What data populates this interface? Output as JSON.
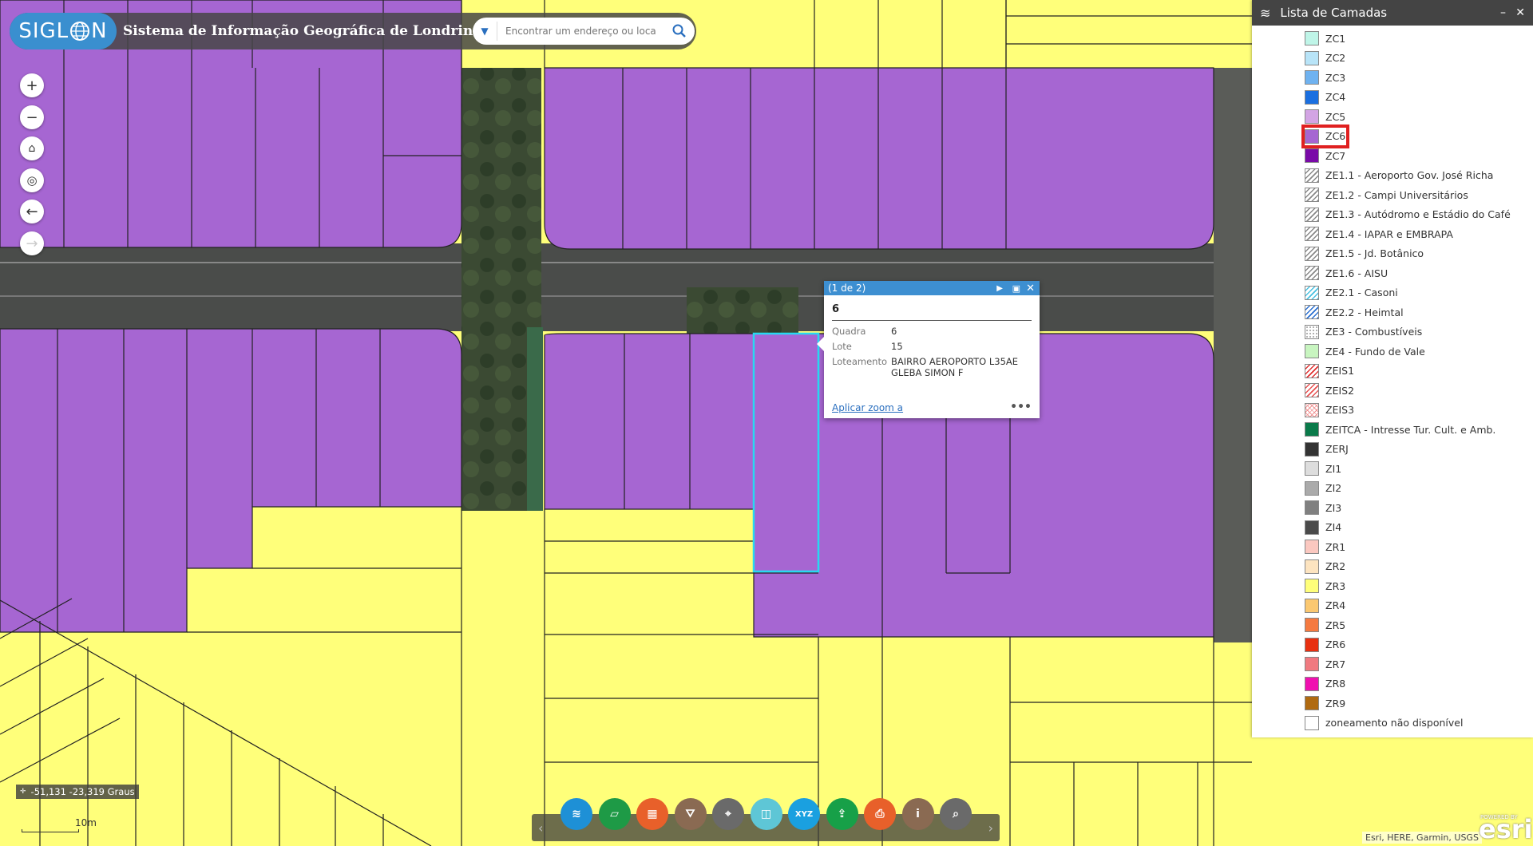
{
  "header": {
    "logo_text_a": "SIGL",
    "logo_text_b": "N",
    "title": "Sistema de Informação Geográfica de Londrina",
    "search_placeholder": "Encontrar um endereço ou loca"
  },
  "layer_panel": {
    "title": "Lista de Camadas",
    "minimize": "–",
    "close": "✕",
    "items": [
      {
        "label": "ZC1",
        "color": "#bff5e8",
        "pattern": "solid"
      },
      {
        "label": "ZC2",
        "color": "#b8e4f8",
        "pattern": "solid"
      },
      {
        "label": "ZC3",
        "color": "#6fb2f0",
        "pattern": "solid"
      },
      {
        "label": "ZC4",
        "color": "#1a6fe0",
        "pattern": "solid"
      },
      {
        "label": "ZC5",
        "color": "#d3a4e4",
        "pattern": "solid"
      },
      {
        "label": "ZC6",
        "color": "#a666d2",
        "pattern": "solid"
      },
      {
        "label": "ZC7",
        "color": "#7a0aa8",
        "pattern": "solid"
      },
      {
        "label": "ZE1.1 - Aeroporto Gov. José Richa",
        "color": "#888888",
        "pattern": "hatch"
      },
      {
        "label": "ZE1.2 - Campi Universitários",
        "color": "#888888",
        "pattern": "hatch"
      },
      {
        "label": "ZE1.3 - Autódromo e Estádio do Café",
        "color": "#888888",
        "pattern": "hatch"
      },
      {
        "label": "ZE1.4 - IAPAR e EMBRAPA",
        "color": "#888888",
        "pattern": "hatch"
      },
      {
        "label": "ZE1.5 - Jd. Botânico",
        "color": "#888888",
        "pattern": "hatch"
      },
      {
        "label": "ZE1.6 - AISU",
        "color": "#888888",
        "pattern": "hatch"
      },
      {
        "label": "ZE2.1 - Casoni",
        "color": "#48c0e0",
        "pattern": "hatch"
      },
      {
        "label": "ZE2.2 - Heimtal",
        "color": "#2a6fd0",
        "pattern": "hatch"
      },
      {
        "label": "ZE3 - Combustíveis",
        "color": "#999999",
        "pattern": "dots"
      },
      {
        "label": "ZE4 - Fundo de Vale",
        "color": "#c8f5c0",
        "pattern": "solid"
      },
      {
        "label": "ZEIS1",
        "color": "#e03030",
        "pattern": "hatch"
      },
      {
        "label": "ZEIS2",
        "color": "#e85050",
        "pattern": "hatch"
      },
      {
        "label": "ZEIS3",
        "color": "#f09090",
        "pattern": "cross"
      },
      {
        "label": "ZEITCA - Intresse Tur. Cult. e Amb.",
        "color": "#0a7a4a",
        "pattern": "solid"
      },
      {
        "label": "ZERJ",
        "color": "#333333",
        "pattern": "solid"
      },
      {
        "label": "ZI1",
        "color": "#dddddd",
        "pattern": "solid"
      },
      {
        "label": "ZI2",
        "color": "#aaaaaa",
        "pattern": "solid"
      },
      {
        "label": "ZI3",
        "color": "#808080",
        "pattern": "solid"
      },
      {
        "label": "ZI4",
        "color": "#4a4a4a",
        "pattern": "solid"
      },
      {
        "label": "ZR1",
        "color": "#fbc8c0",
        "pattern": "solid"
      },
      {
        "label": "ZR2",
        "color": "#fde4c0",
        "pattern": "solid"
      },
      {
        "label": "ZR3",
        "color": "#ffff7a",
        "pattern": "solid"
      },
      {
        "label": "ZR4",
        "color": "#fbc870",
        "pattern": "solid"
      },
      {
        "label": "ZR5",
        "color": "#f57a40",
        "pattern": "solid"
      },
      {
        "label": "ZR6",
        "color": "#e83010",
        "pattern": "solid"
      },
      {
        "label": "ZR7",
        "color": "#f07a80",
        "pattern": "solid"
      },
      {
        "label": "ZR8",
        "color": "#f010b0",
        "pattern": "solid"
      },
      {
        "label": "ZR9",
        "color": "#b06a10",
        "pattern": "solid"
      },
      {
        "label": "zoneamento não disponível",
        "color": "#ffffff",
        "pattern": "solid"
      }
    ]
  },
  "popup": {
    "pager": "(1 de 2)",
    "title": "6",
    "fields": [
      {
        "label": "Quadra",
        "value": "6"
      },
      {
        "label": "Lote",
        "value": "15"
      },
      {
        "label": "Loteamento",
        "value": "BAIRRO AEROPORTO L35AE GLEBA SIMON F"
      }
    ],
    "zoom_link": "Aplicar zoom a",
    "more": "•••"
  },
  "map": {
    "coordinates": "-51,131 -23,319 Graus",
    "scale_label": "10m",
    "attribution": "Esri, HERE, Garmin, USGS",
    "esri_logo": "esri",
    "esri_powered": "POWERED BY",
    "zone_colors": {
      "residential": "#ffff7a",
      "commercial": "#a666d2",
      "selected_outline": "#28d8f0"
    }
  },
  "toolbar": {
    "tools": [
      {
        "name": "layers",
        "color": "#1e90d6",
        "glyph": "≋"
      },
      {
        "name": "measure",
        "color": "#1e9a46",
        "glyph": "▱"
      },
      {
        "name": "basemap",
        "color": "#e8602a",
        "glyph": "▦"
      },
      {
        "name": "filter",
        "color": "#8a6a52",
        "glyph": "⛛"
      },
      {
        "name": "locate",
        "color": "#6a6a6a",
        "glyph": "⌖"
      },
      {
        "name": "swipe",
        "color": "#5ec6d6",
        "glyph": "◫"
      },
      {
        "name": "xyz",
        "color": "#1aa0e0",
        "glyph": "XYZ"
      },
      {
        "name": "share",
        "color": "#17a048",
        "glyph": "⇪"
      },
      {
        "name": "print",
        "color": "#e8602a",
        "glyph": "⎙"
      },
      {
        "name": "about",
        "color": "#8a6a52",
        "glyph": "i"
      },
      {
        "name": "query",
        "color": "#6a6a6a",
        "glyph": "⌕"
      }
    ]
  }
}
